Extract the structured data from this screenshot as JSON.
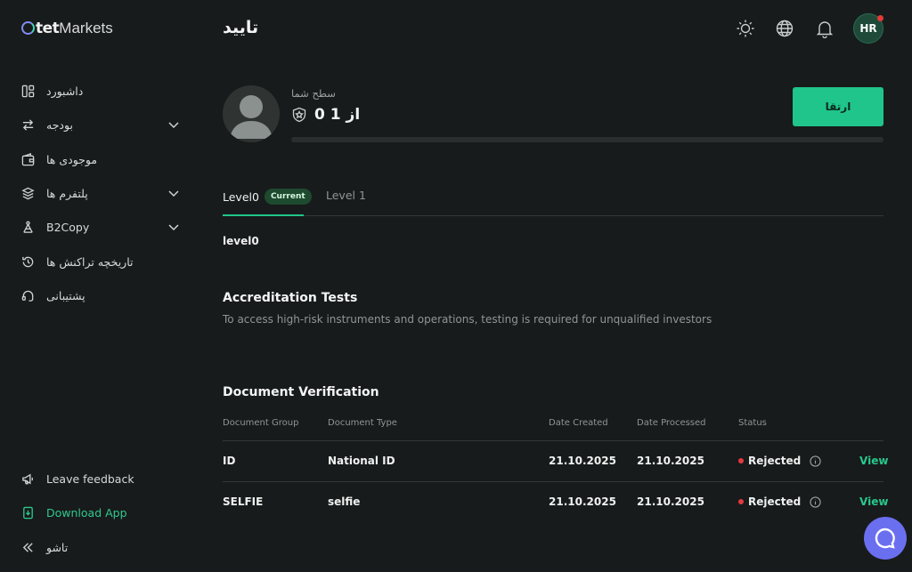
{
  "logo": {
    "o": "O",
    "tet": "tet",
    "markets": "Markets"
  },
  "sidebar": {
    "items": [
      {
        "label": "داشبورد"
      },
      {
        "label": "بودجه"
      },
      {
        "label": "موجودی ها"
      },
      {
        "label": "پلتفرم ها"
      },
      {
        "label": "B2Copy"
      },
      {
        "label": "تاریخچه تراکنش ها"
      },
      {
        "label": "پشتیبانی"
      }
    ],
    "bottom": [
      {
        "label": "Leave feedback"
      },
      {
        "label": "Download App"
      },
      {
        "label": "تاشو"
      }
    ]
  },
  "header": {
    "title": "تایید",
    "avatar_initials": "HR"
  },
  "level_card": {
    "label": "سطح شما",
    "value": "از 1 0",
    "progress": 0,
    "upgrade_label": "ارتقا"
  },
  "tabs": [
    {
      "label": "Level0",
      "badge": "Current"
    },
    {
      "label": "Level 1"
    }
  ],
  "level_name": "level0",
  "accreditation": {
    "title": "Accreditation Tests",
    "description": "To access high-risk instruments and operations, testing is required for unqualified investors"
  },
  "documents": {
    "title": "Document Verification",
    "columns": [
      "Document Group",
      "Document Type",
      "Date Created",
      "Date Processed",
      "Status"
    ],
    "rows": [
      {
        "group": "ID",
        "type": "National ID",
        "created": "21.10.2025",
        "processed": "21.10.2025",
        "status": "Rejected",
        "action": "View"
      },
      {
        "group": "SELFIE",
        "type": "selfie",
        "created": "21.10.2025",
        "processed": "21.10.2025",
        "status": "Rejected",
        "action": "View"
      }
    ]
  },
  "colors": {
    "accent": "#1fc58a",
    "rejected": "#e53940",
    "background": "#181b1b",
    "chat": "#6a6ff0"
  }
}
